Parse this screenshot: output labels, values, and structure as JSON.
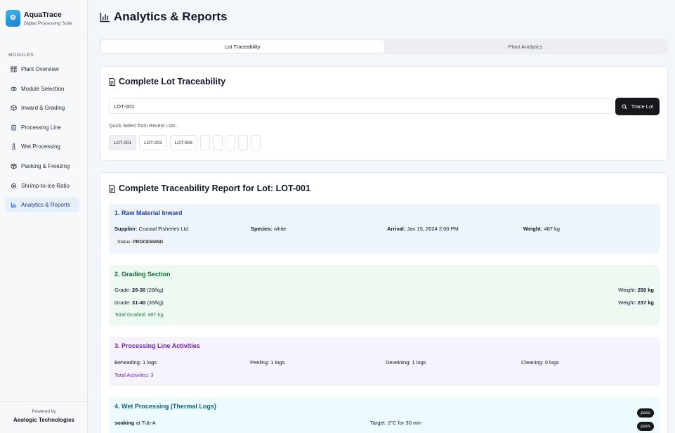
{
  "brand": {
    "name": "AquaTrace",
    "subtitle": "Digital Processing Suite"
  },
  "sidebar": {
    "section_label": "MODULES",
    "items": [
      {
        "label": "Plant Overview",
        "icon": "grid-icon"
      },
      {
        "label": "Module Selection",
        "icon": "cube-stack-icon"
      },
      {
        "label": "Inward & Grading",
        "icon": "cube-icon"
      },
      {
        "label": "Processing Line",
        "icon": "clipboard-icon"
      },
      {
        "label": "Wet Processing",
        "icon": "thermometer-icon"
      },
      {
        "label": "Packing & Freezing",
        "icon": "package-icon"
      },
      {
        "label": "Shrimp-to-Ice Ratio",
        "icon": "scale-icon"
      },
      {
        "label": "Analytics & Reports",
        "icon": "bar-chart-icon",
        "active": true
      }
    ],
    "footer": {
      "powered_by": "Powered by",
      "company": "Aeologic Technologies"
    }
  },
  "header": {
    "title": "Analytics & Reports"
  },
  "tabs": [
    {
      "label": "Lot Traceability",
      "active": true
    },
    {
      "label": "Plant Analytics",
      "active": false
    }
  ],
  "trace": {
    "title": "Complete Lot Traceability",
    "search_value": "LOT-001",
    "button_label": "Trace Lot",
    "quick_label": "Quick Select from Recent Lots:",
    "lots": [
      "LOT-001",
      "LOT-002",
      "LOT-003",
      "",
      "",
      "",
      "",
      ""
    ]
  },
  "report": {
    "title": "Complete Traceability Report for Lot: LOT-001",
    "raw": {
      "title": "1. Raw Material Inward",
      "supplier_label": "Supplier:",
      "supplier": "Coastal Fisheries Ltd",
      "species_label": "Species:",
      "species": "white",
      "arrival_label": "Arrival:",
      "arrival": "Jan 15, 2024 2:00 PM",
      "weight_label": "Weight:",
      "weight": "487 kg",
      "status_label": "Status:",
      "status": "PROCESSING"
    },
    "grading": {
      "title": "2. Grading Section",
      "grade_label": "Grade:",
      "weight_label": "Weight:",
      "rows": [
        {
          "grade": "26-30",
          "count": "(28/kg)",
          "weight": "250 kg"
        },
        {
          "grade": "31-40",
          "count": "(35/kg)",
          "weight": "237 kg"
        }
      ],
      "total": "Total Graded: 487 kg"
    },
    "processing": {
      "title": "3. Processing Line Activities",
      "activities": [
        "Beheading: 1 logs",
        "Peeling: 1 logs",
        "Deveining: 1 logs",
        "Cleaning: 0 logs"
      ],
      "total": "Total Activities: 3"
    },
    "wet": {
      "title": "4. Wet Processing (Thermal Logs)",
      "logs": [
        {
          "process": "soaking",
          "location": "at Tub-A",
          "target": "Target: 2°C for 30 min",
          "result": "pass"
        },
        {
          "result": "pass"
        }
      ]
    }
  },
  "colors": {
    "accent": "#1d4ed8",
    "raw_title": "#1e40af",
    "grading_title": "#166534",
    "processing_title": "#6b21a8",
    "wet_title": "#155e75",
    "button_dark": "#16181d"
  }
}
